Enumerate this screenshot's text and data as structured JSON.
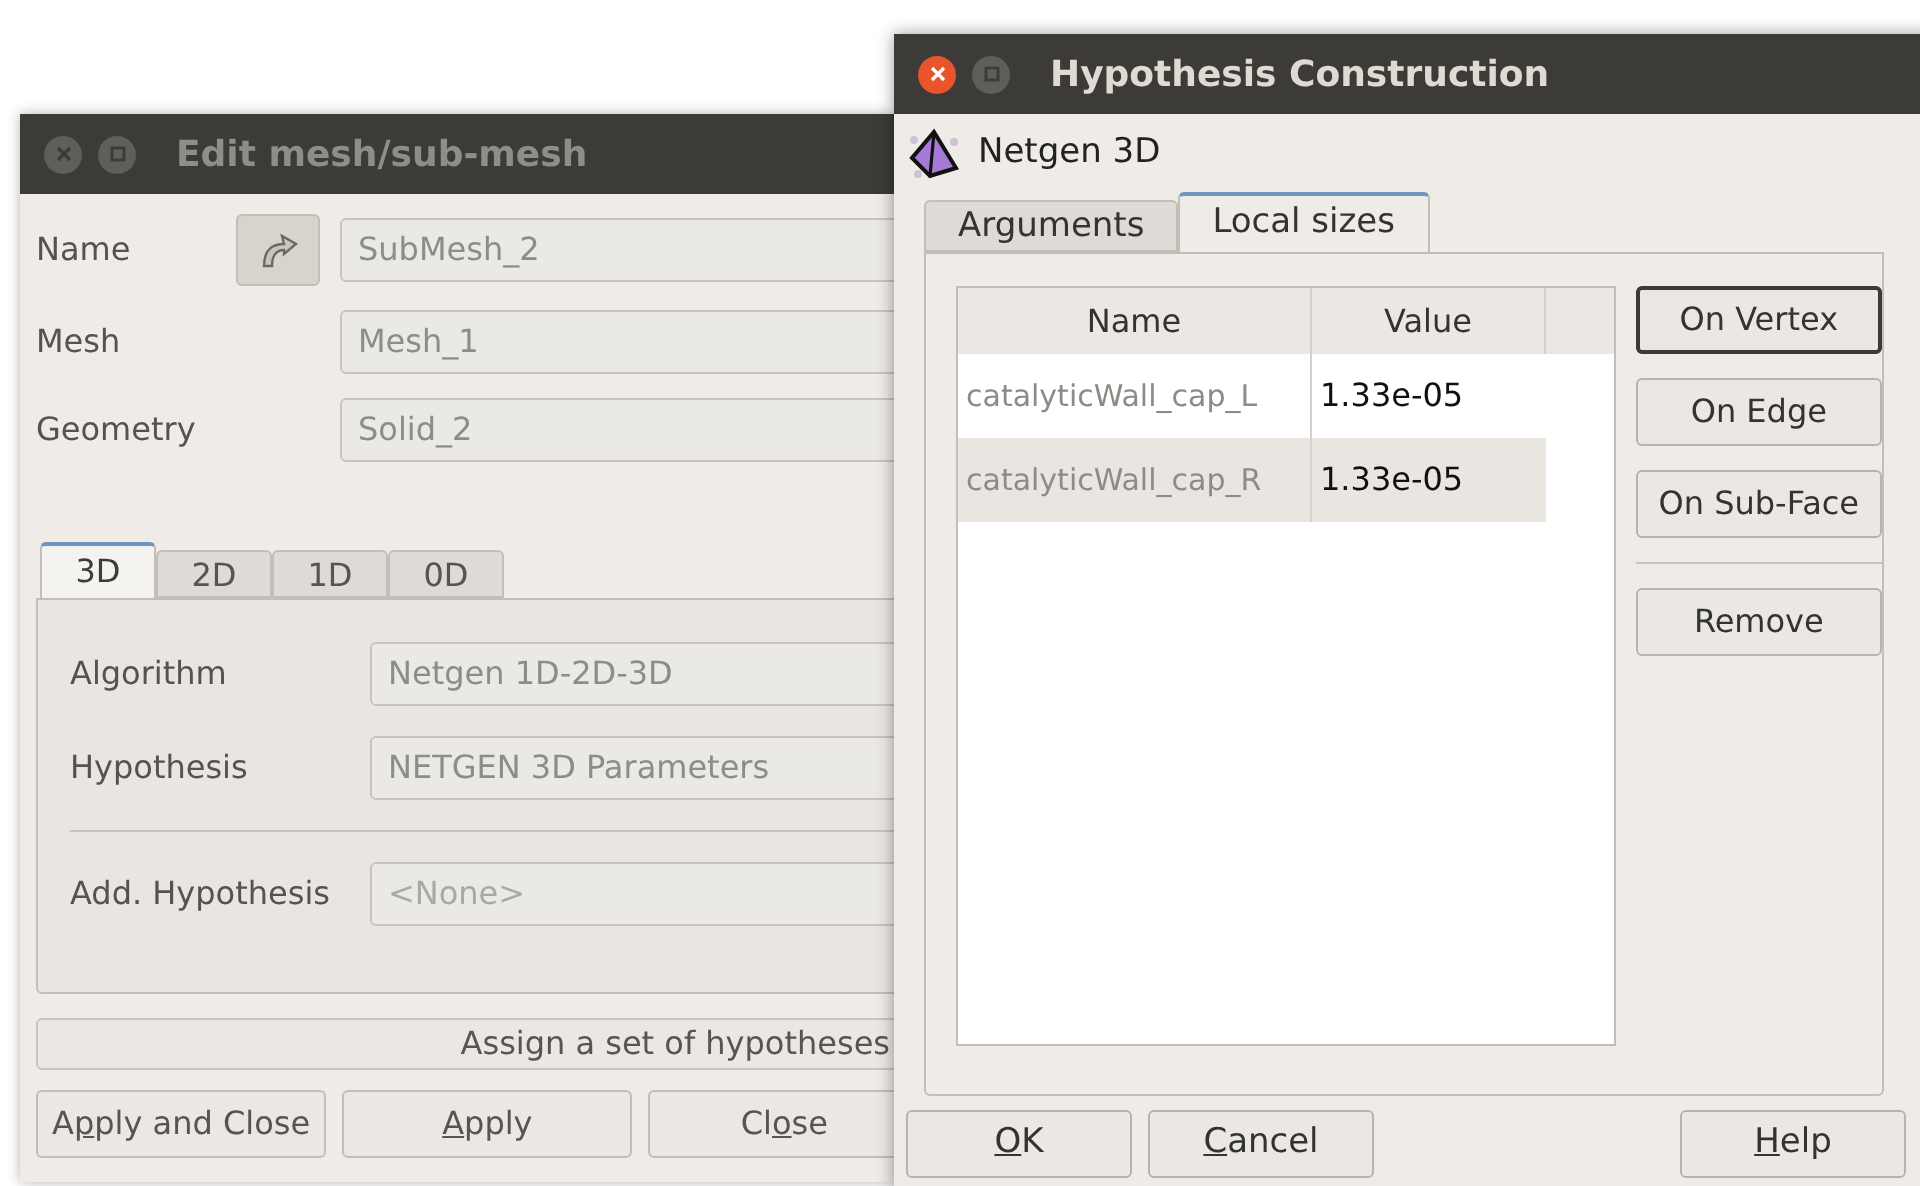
{
  "edit_dialog": {
    "title": "Edit mesh/sub-mesh",
    "active": false,
    "fields": [
      {
        "label": "Name",
        "value": "SubMesh_2",
        "disabled": true,
        "kind": "select"
      },
      {
        "label": "Mesh",
        "value": "Mesh_1",
        "disabled": true,
        "kind": "plain"
      },
      {
        "label": "Geometry",
        "value": "Solid_2",
        "disabled": true,
        "kind": "plain"
      }
    ],
    "tabs": [
      {
        "label": "3D",
        "selected": true
      },
      {
        "label": "2D",
        "selected": false
      },
      {
        "label": "1D",
        "selected": false
      },
      {
        "label": "0D",
        "selected": false
      }
    ],
    "algorithm": {
      "label": "Algorithm",
      "value": "Netgen 1D-2D-3D"
    },
    "hypothesis": {
      "label": "Hypothesis",
      "value": "NETGEN 3D Parameters"
    },
    "add_hypothesis": {
      "label": "Add. Hypothesis",
      "placeholder": "<None>"
    },
    "assign_button": "Assign a set of hypotheses",
    "buttons": [
      {
        "label": {
          "before": "A",
          "key": "p",
          "after": "ply and Close"
        }
      },
      {
        "label": {
          "key": "A",
          "after": "pply"
        }
      },
      {
        "label": {
          "before": "Cl",
          "key": "o",
          "after": "se"
        }
      }
    ]
  },
  "hypothesis_dialog": {
    "title": "Hypothesis Construction",
    "active": true,
    "algorithm": "Netgen 3D",
    "tabs": [
      {
        "label": "Arguments",
        "selected": false
      },
      {
        "label": "Local sizes",
        "selected": true
      }
    ],
    "table": {
      "columns": [
        "Name",
        "Value"
      ],
      "rows": [
        {
          "name": "catalyticWall_cap_L",
          "value": "1.33e-05"
        },
        {
          "name": "catalyticWall_cap_R",
          "value": "1.33e-05"
        }
      ]
    },
    "side_buttons": [
      {
        "label": "On Vertex",
        "default": true,
        "kind": "button"
      },
      {
        "label": "On Edge",
        "default": false,
        "kind": "button"
      },
      {
        "label": "On Sub-Face",
        "default": false,
        "kind": "button"
      },
      {
        "kind": "separator"
      },
      {
        "label": "Remove",
        "default": false,
        "kind": "button"
      }
    ],
    "buttons": [
      {
        "label": {
          "key": "O",
          "after": "K"
        }
      },
      {
        "label": {
          "key": "C",
          "after": "ancel"
        }
      },
      {
        "label": {
          "key": "H",
          "after": "elp"
        }
      }
    ]
  }
}
